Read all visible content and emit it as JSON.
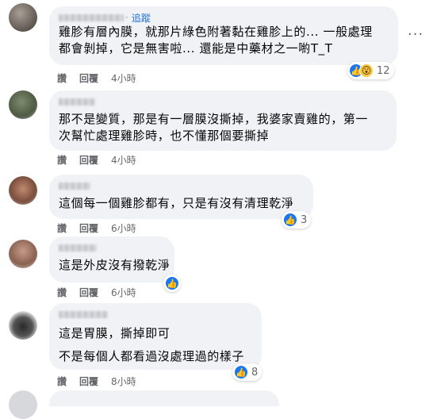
{
  "comments": [
    {
      "follow": "追蹤",
      "lines": [
        "雞胗有層內膜，就那片綠色附著黏在雞胗上的... 一般處理",
        "都會剝掉，它是無害啦... 還能是中藥材之一喲T_T"
      ],
      "like": "讚",
      "reply": "回覆",
      "time": "4小時",
      "reactions": "12"
    },
    {
      "lines": [
        "那不是變質，那是有一層膜沒撕掉，我婆家賣雞的，第一",
        "次幫忙處理雞胗時，也不懂那個要撕掉"
      ],
      "like": "讚",
      "reply": "回覆",
      "time": "4小時"
    },
    {
      "lines": [
        "這個每一個雞胗都有，只是有沒有清理乾淨"
      ],
      "like": "讚",
      "reply": "回覆",
      "time": "6小時",
      "reactions": "3"
    },
    {
      "lines": [
        "這是外皮沒有撥乾淨"
      ],
      "like": "讚",
      "reply": "回覆",
      "time": "6小時"
    },
    {
      "lines": [
        "這是胃膜，撕掉即可",
        "不是每個人都看過沒處理過的樣子"
      ],
      "like": "讚",
      "reply": "回覆",
      "time": "8小時",
      "reactions": "8"
    }
  ],
  "icons": {
    "more": "more-options-icon",
    "like": "like-icon",
    "wow": "wow-icon"
  },
  "colors": {
    "bubble": "#f0f2f5",
    "link": "#216fdb",
    "like": "#1877f2"
  }
}
